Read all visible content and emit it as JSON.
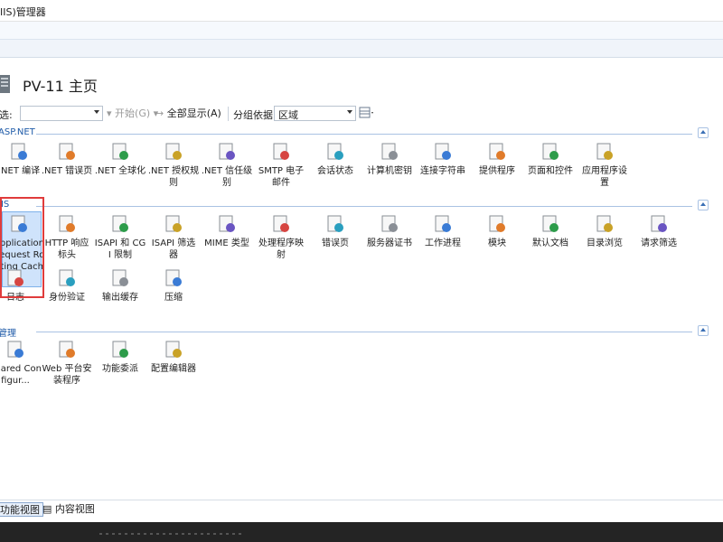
{
  "window": {
    "title": "IIS)管理器"
  },
  "header": {
    "title": "PV-11 主页"
  },
  "toolbar": {
    "filter_label": "筛选:",
    "filter_value": "",
    "start_label": "开始(G)",
    "show_all_label": "全部显示(A)",
    "group_label": "分组依据:",
    "group_value": "区域"
  },
  "sections": {
    "aspnet": {
      "title": "ASP.NET"
    },
    "iis": {
      "title": "IIS"
    },
    "management": {
      "title": "管理"
    }
  },
  "aspnet_features": [
    {
      "label": ".NET 编译",
      "icon": "dotnet-compile-icon"
    },
    {
      "label": ".NET 错误页",
      "icon": "dotnet-error-page-icon"
    },
    {
      "label": ".NET 全球化",
      "icon": "globe-icon"
    },
    {
      "label": ".NET 授权规则",
      "icon": "lock-doc-icon"
    },
    {
      "label": ".NET 信任级别",
      "icon": "trust-level-icon"
    },
    {
      "label": "SMTP 电子邮件",
      "icon": "smtp-mail-icon"
    },
    {
      "label": "会话状态",
      "icon": "session-state-icon"
    },
    {
      "label": "计算机密钥",
      "icon": "machine-key-icon"
    },
    {
      "label": "连接字符串",
      "icon": "connection-string-icon"
    },
    {
      "label": "提供程序",
      "icon": "providers-icon"
    },
    {
      "label": "页面和控件",
      "icon": "pages-controls-icon"
    },
    {
      "label": "应用程序设置",
      "icon": "app-settings-icon"
    }
  ],
  "iis_features": [
    {
      "label": "Application Request Routing Cache",
      "icon": "arr-cache-icon"
    },
    {
      "label": "HTTP 响应标头",
      "icon": "http-headers-icon"
    },
    {
      "label": "ISAPI 和 CGI 限制",
      "icon": "isapi-cgi-icon"
    },
    {
      "label": "ISAPI 筛选器",
      "icon": "isapi-filter-icon"
    },
    {
      "label": "MIME 类型",
      "icon": "mime-icon"
    },
    {
      "label": "处理程序映射",
      "icon": "handler-mapping-icon"
    },
    {
      "label": "错误页",
      "icon": "error-page-icon"
    },
    {
      "label": "服务器证书",
      "icon": "certificate-icon"
    },
    {
      "label": "工作进程",
      "icon": "worker-process-icon"
    },
    {
      "label": "模块",
      "icon": "modules-icon"
    },
    {
      "label": "默认文档",
      "icon": "default-doc-icon"
    },
    {
      "label": "目录浏览",
      "icon": "dir-browse-icon"
    },
    {
      "label": "请求筛选",
      "icon": "request-filter-icon"
    },
    {
      "label": "日志",
      "icon": "logging-icon"
    },
    {
      "label": "身份验证",
      "icon": "auth-icon"
    },
    {
      "label": "输出缓存",
      "icon": "output-cache-icon"
    },
    {
      "label": "压缩",
      "icon": "compression-icon"
    }
  ],
  "management_features": [
    {
      "label": "Shared Configur...",
      "icon": "shared-config-icon"
    },
    {
      "label": "Web 平台安装程序",
      "icon": "web-platform-icon"
    },
    {
      "label": "功能委派",
      "icon": "feature-delegation-icon"
    },
    {
      "label": "配置编辑器",
      "icon": "config-editor-icon"
    }
  ],
  "bottom_tabs": {
    "features_view": "功能视图",
    "content_view": "内容视图"
  }
}
